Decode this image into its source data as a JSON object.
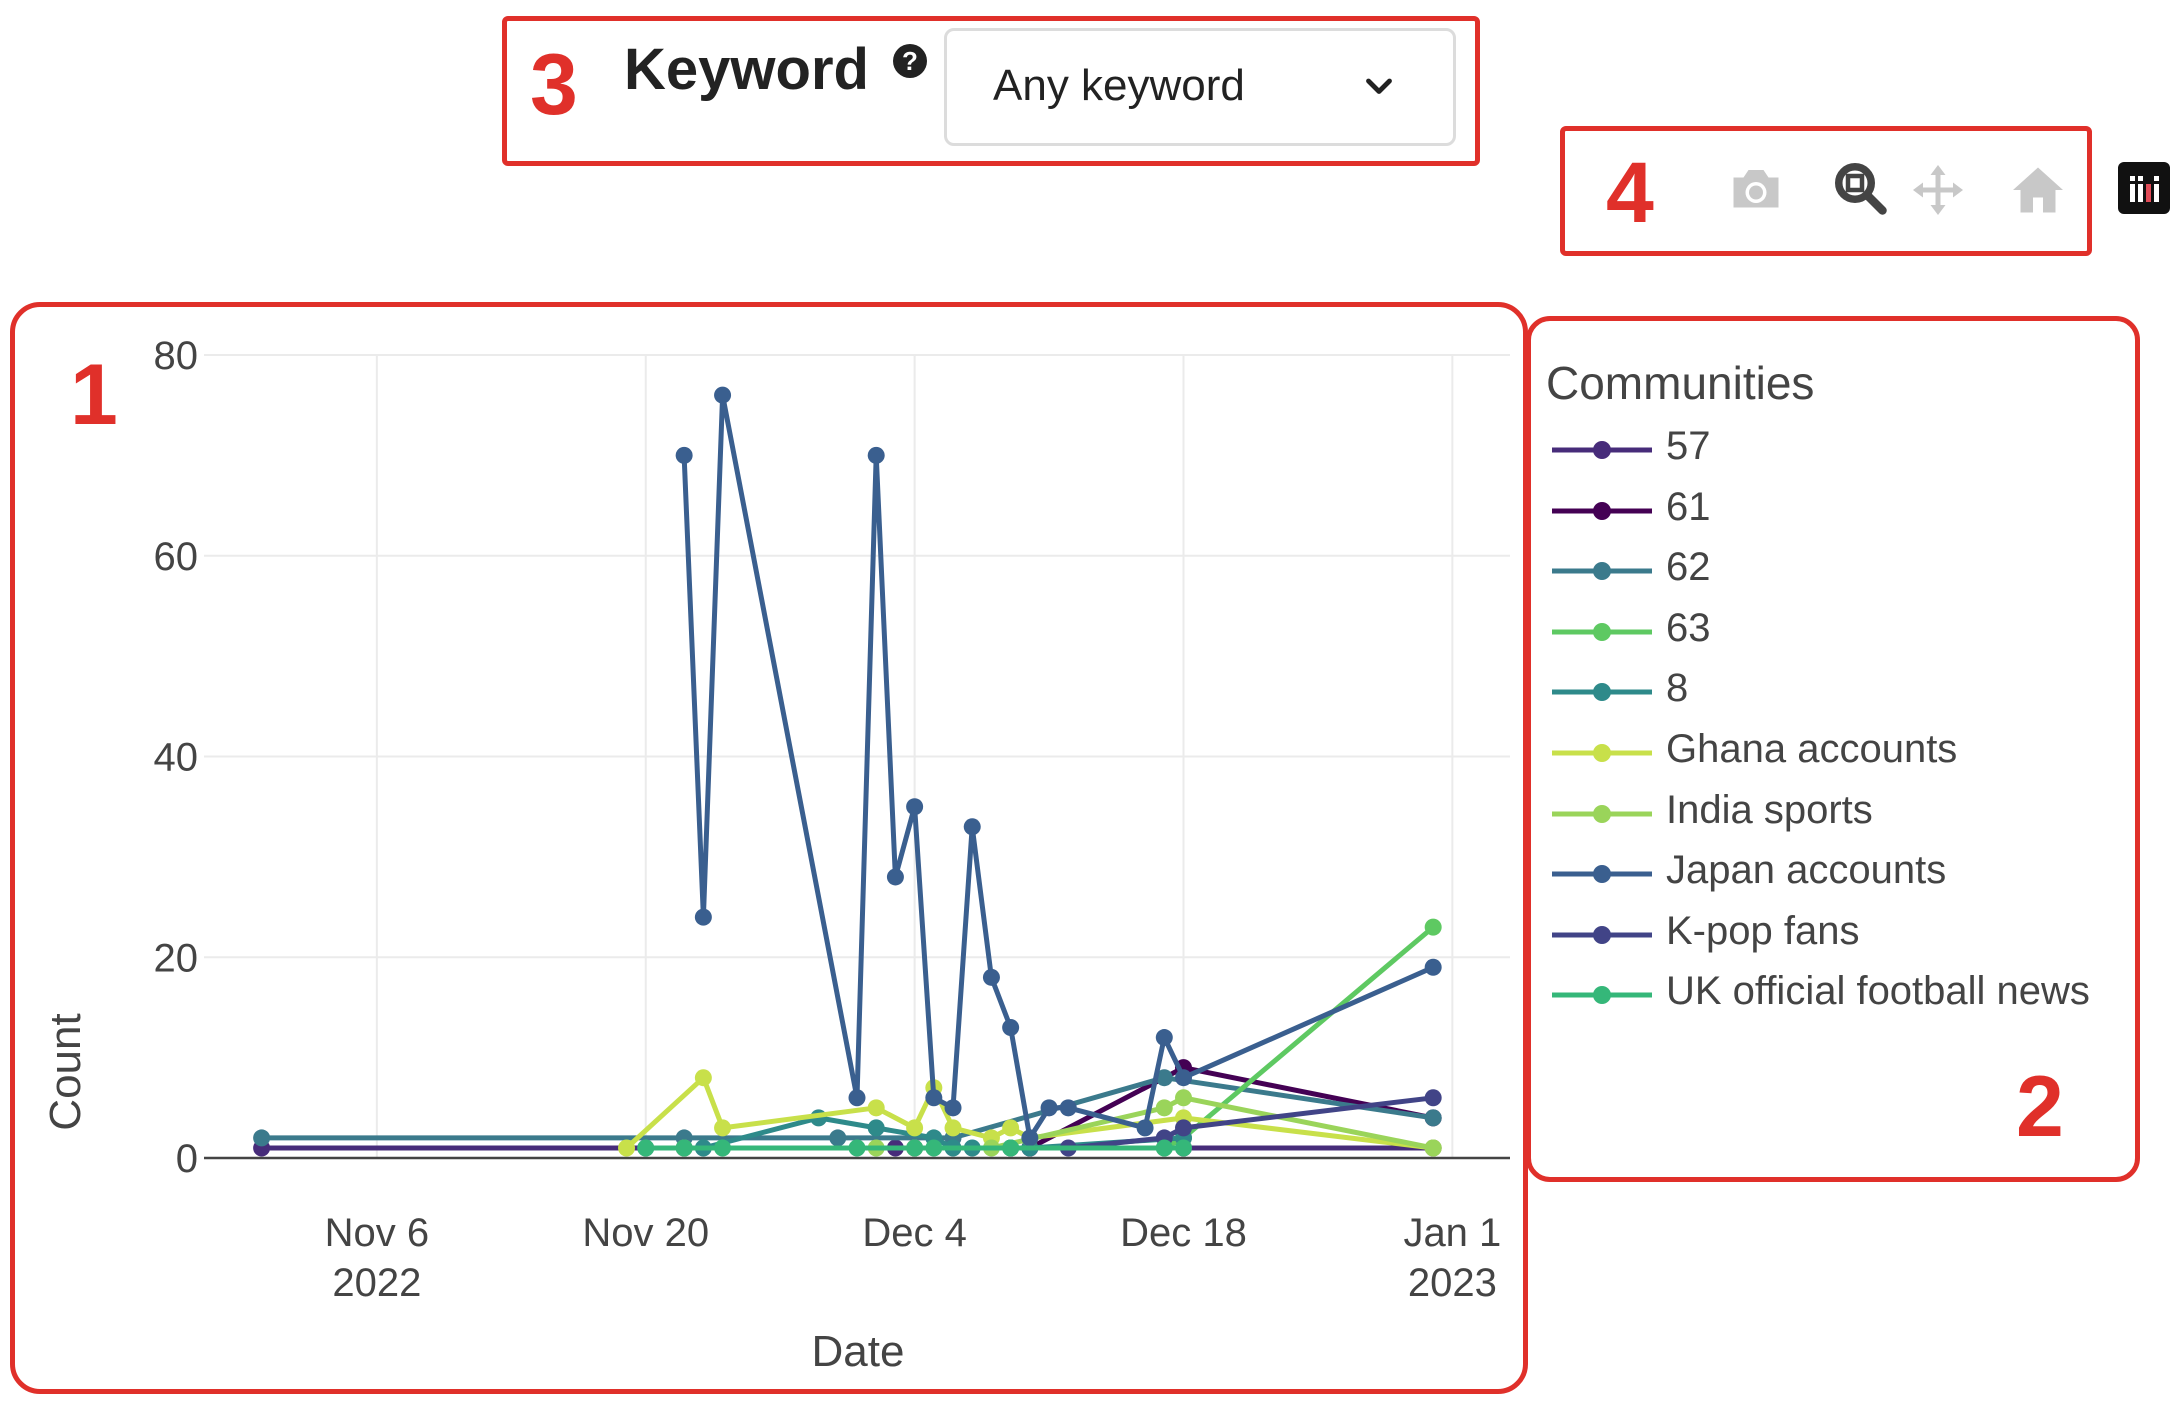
{
  "keyword": {
    "label": "Keyword",
    "help": "?",
    "selected": "Any keyword"
  },
  "callouts": {
    "chart": "1",
    "legend": "2",
    "keyword": "3",
    "modebar": "4"
  },
  "modebar": {
    "buttons": [
      {
        "name": "camera-icon",
        "title": "Download plot as a png"
      },
      {
        "name": "zoom-icon",
        "title": "Zoom"
      },
      {
        "name": "pan-icon",
        "title": "Pan"
      },
      {
        "name": "home-icon",
        "title": "Reset axes"
      }
    ]
  },
  "chart_data": {
    "type": "line",
    "xlabel": "Date",
    "ylabel": "Count",
    "ylim": [
      0,
      80
    ],
    "yticks": [
      0,
      20,
      40,
      60,
      80
    ],
    "xlim": [
      "2022-10-28",
      "2023-01-04"
    ],
    "xticks": [
      {
        "date": "2022-11-06",
        "label": "Nov 6",
        "sub": "2022"
      },
      {
        "date": "2022-11-20",
        "label": "Nov 20",
        "sub": ""
      },
      {
        "date": "2022-12-04",
        "label": "Dec 4",
        "sub": ""
      },
      {
        "date": "2022-12-18",
        "label": "Dec 18",
        "sub": ""
      },
      {
        "date": "2023-01-01",
        "label": "Jan 1",
        "sub": "2023"
      }
    ],
    "grid": true,
    "legend": {
      "title": "Communities",
      "placement": "right"
    },
    "series": [
      {
        "name": "57",
        "color": "#472c7a",
        "points": [
          [
            "2022-10-31",
            1
          ],
          [
            "2022-11-22",
            1
          ],
          [
            "2022-12-03",
            1
          ],
          [
            "2022-12-10",
            1
          ],
          [
            "2022-12-18",
            1
          ],
          [
            "2022-12-31",
            1
          ]
        ]
      },
      {
        "name": "61",
        "color": "#440154",
        "points": [
          [
            "2022-12-04",
            1
          ],
          [
            "2022-12-10",
            1
          ],
          [
            "2022-12-18",
            9
          ],
          [
            "2022-12-31",
            4
          ]
        ]
      },
      {
        "name": "62",
        "color": "#3b7a8c",
        "points": [
          [
            "2022-10-31",
            2
          ],
          [
            "2022-11-22",
            2
          ],
          [
            "2022-11-30",
            2
          ],
          [
            "2022-12-06",
            2
          ],
          [
            "2022-12-17",
            8
          ],
          [
            "2022-12-31",
            4
          ]
        ]
      },
      {
        "name": "63",
        "color": "#5ec962",
        "points": [
          [
            "2022-12-09",
            1
          ],
          [
            "2022-12-17",
            1
          ],
          [
            "2022-12-18",
            2
          ],
          [
            "2022-12-31",
            23
          ]
        ]
      },
      {
        "name": "8",
        "color": "#2e8a8a",
        "points": [
          [
            "2022-11-20",
            1
          ],
          [
            "2022-11-22",
            1
          ],
          [
            "2022-11-23",
            1
          ],
          [
            "2022-11-29",
            4
          ],
          [
            "2022-12-02",
            3
          ],
          [
            "2022-12-05",
            2
          ],
          [
            "2022-12-06",
            1
          ],
          [
            "2022-12-07",
            1
          ],
          [
            "2022-12-09",
            1
          ],
          [
            "2022-12-10",
            1
          ],
          [
            "2022-12-18",
            2
          ]
        ]
      },
      {
        "name": "Ghana accounts",
        "color": "#c8e04a",
        "points": [
          [
            "2022-11-19",
            1
          ],
          [
            "2022-11-23",
            8
          ],
          [
            "2022-11-24",
            3
          ],
          [
            "2022-12-02",
            5
          ],
          [
            "2022-12-04",
            3
          ],
          [
            "2022-12-05",
            7
          ],
          [
            "2022-12-06",
            3
          ],
          [
            "2022-12-08",
            2
          ],
          [
            "2022-12-09",
            3
          ],
          [
            "2022-12-10",
            2
          ],
          [
            "2022-12-18",
            4
          ],
          [
            "2022-12-31",
            1
          ]
        ]
      },
      {
        "name": "India sports",
        "color": "#9ad45a",
        "points": [
          [
            "2022-11-22",
            1
          ],
          [
            "2022-12-02",
            1
          ],
          [
            "2022-12-04",
            1
          ],
          [
            "2022-12-08",
            1
          ],
          [
            "2022-12-17",
            5
          ],
          [
            "2022-12-18",
            6
          ],
          [
            "2022-12-31",
            1
          ]
        ]
      },
      {
        "name": "Japan accounts",
        "color": "#3a5f8f",
        "points": [
          [
            "2022-11-22",
            70
          ],
          [
            "2022-11-23",
            24
          ],
          [
            "2022-11-24",
            76
          ],
          [
            "2022-12-01",
            6
          ],
          [
            "2022-12-02",
            70
          ],
          [
            "2022-12-03",
            28
          ],
          [
            "2022-12-04",
            35
          ],
          [
            "2022-12-05",
            6
          ],
          [
            "2022-12-06",
            5
          ],
          [
            "2022-12-07",
            33
          ],
          [
            "2022-12-08",
            18
          ],
          [
            "2022-12-09",
            13
          ],
          [
            "2022-12-10",
            2
          ],
          [
            "2022-12-11",
            5
          ],
          [
            "2022-12-12",
            5
          ],
          [
            "2022-12-16",
            3
          ],
          [
            "2022-12-17",
            12
          ],
          [
            "2022-12-18",
            8
          ],
          [
            "2022-12-31",
            19
          ]
        ]
      },
      {
        "name": "K-pop fans",
        "color": "#414487",
        "points": [
          [
            "2022-12-12",
            1
          ],
          [
            "2022-12-17",
            2
          ],
          [
            "2022-12-18",
            3
          ],
          [
            "2022-12-31",
            6
          ]
        ]
      },
      {
        "name": "UK official football news",
        "color": "#35b779",
        "points": [
          [
            "2022-11-20",
            1
          ],
          [
            "2022-11-22",
            1
          ],
          [
            "2022-11-24",
            1
          ],
          [
            "2022-12-01",
            1
          ],
          [
            "2022-12-04",
            1
          ],
          [
            "2022-12-05",
            1
          ],
          [
            "2022-12-09",
            1
          ],
          [
            "2022-12-17",
            1
          ],
          [
            "2022-12-18",
            1
          ]
        ]
      }
    ]
  }
}
